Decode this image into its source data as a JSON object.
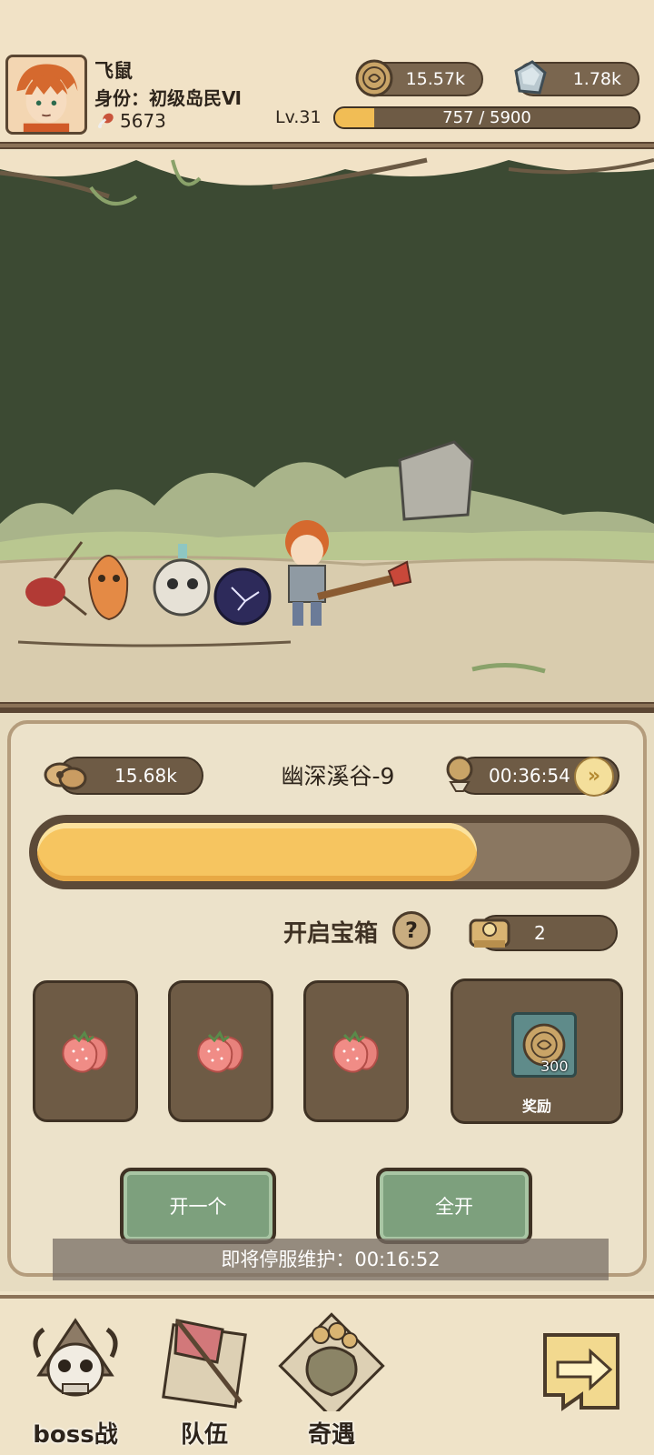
{
  "player": {
    "name": "飞鼠",
    "title": "身份：初级岛民Ⅵ",
    "power": "5673",
    "level_label": "Lv.31",
    "exp_text": "757 / 5900",
    "exp_fraction": 0.128
  },
  "resources": {
    "coins": "15.57k",
    "gems": "1.78k",
    "coin_icon": "coin-icon",
    "gem_icon": "crystal-icon"
  },
  "stage": {
    "food": "15.68k",
    "name": "幽深溪谷-9",
    "timer": "00:36:54",
    "progress_fraction": 0.74
  },
  "chest": {
    "label": "开启宝箱",
    "help": "?",
    "keys": "2",
    "slot_items": [
      "strawberry-icon",
      "strawberry-icon",
      "strawberry-icon"
    ],
    "reward_qty": "300",
    "reward_label": "奖励"
  },
  "actions": {
    "open_one": "开一个",
    "open_all": "全开",
    "ff": "»"
  },
  "notice": "即将停服维护：00:16:52",
  "nav": {
    "boss": "boss战",
    "team": "队伍",
    "event": "奇遇"
  },
  "colors": {
    "panel_bg": "#ece2ca",
    "pill_bg": "#6e5b45",
    "progress_fill": "#f6c560",
    "button_green": "#7da07d",
    "forest_dark": "#3c4a33",
    "ground": "#d9ccae"
  }
}
